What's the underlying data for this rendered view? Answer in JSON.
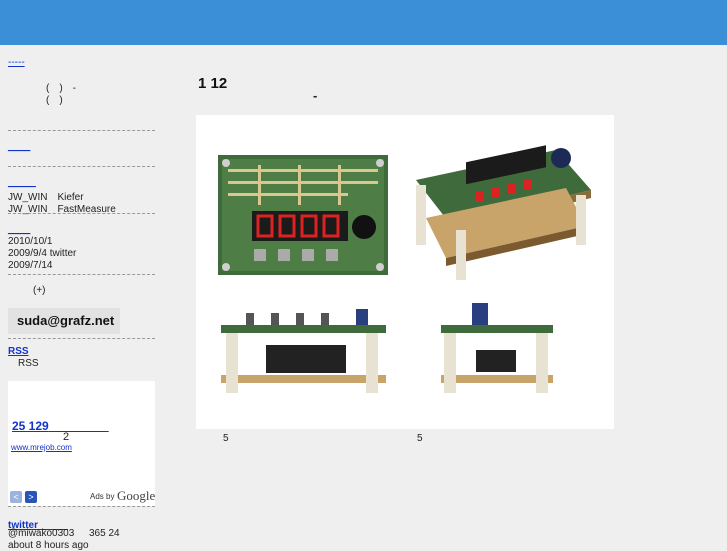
{
  "header": {},
  "sidebar": {
    "top_link": "-----",
    "profile_lines": [
      "(　)　-",
      "(　)"
    ],
    "link_a": "____",
    "software": {
      "heading": "_____",
      "items": [
        "JW_WIN　Kiefer",
        "JW_WIN　FastMeasure"
      ]
    },
    "news": {
      "heading": "____",
      "items": [
        "2010/10/1",
        "2009/9/4 twitter",
        "2009/7/14"
      ]
    },
    "plus_text": "(+)",
    "email": "suda@grafz.net",
    "rss": {
      "heading": "RSS",
      "item": "RSS"
    },
    "ad": {
      "title": "25  129",
      "count": "2",
      "url": "www.mrejob.com",
      "ads_by": "Ads by",
      "google": "Google",
      "prev": "<",
      "next": ">"
    },
    "twitter": {
      "heading": "twitter",
      "line1_user": "@miwako0303",
      "line1_text": "365 24",
      "line2": "about 8 hours ago"
    }
  },
  "main": {
    "title": "1  12",
    "subtitle": "-",
    "captions": [
      "5",
      "5"
    ]
  }
}
